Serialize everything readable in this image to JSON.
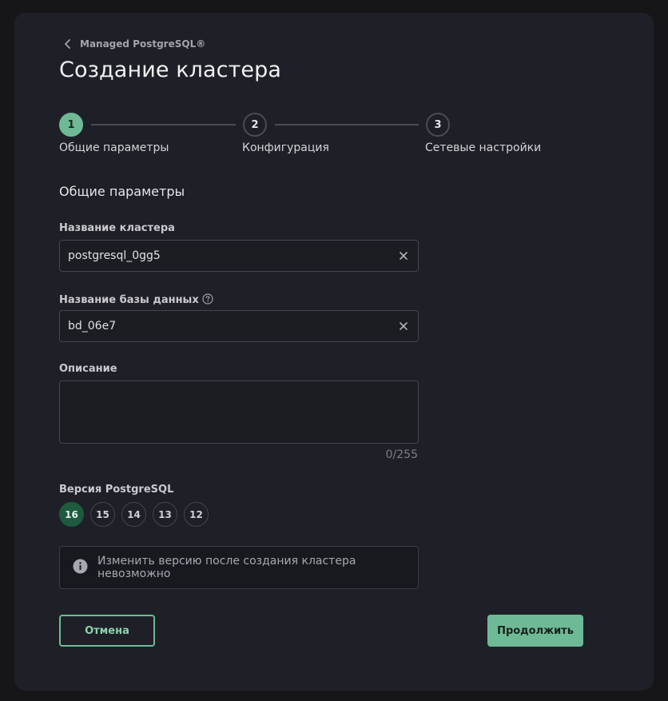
{
  "breadcrumb": {
    "label": "Managed PostgreSQL®",
    "icon": "chevron-left-icon"
  },
  "page": {
    "title": "Создание кластера"
  },
  "stepper": {
    "steps": [
      {
        "number": "1",
        "label": "Общие параметры",
        "state": "active"
      },
      {
        "number": "2",
        "label": "Конфигурация",
        "state": "inactive"
      },
      {
        "number": "3",
        "label": "Сетевые настройки",
        "state": "inactive"
      }
    ]
  },
  "section": {
    "title": "Общие параметры"
  },
  "form": {
    "cluster_name": {
      "label": "Название кластера",
      "value": "postgresql_0gg5",
      "clear_icon": "close-icon"
    },
    "db_name": {
      "label": "Название базы данных",
      "value": "bd_06e7",
      "help_icon": "help-circle-icon",
      "clear_icon": "close-icon"
    },
    "description": {
      "label": "Описание",
      "value": "",
      "counter": "0/255"
    },
    "version": {
      "label": "Версия PostgreSQL",
      "options": [
        "16",
        "15",
        "14",
        "13",
        "12"
      ],
      "selected": "16"
    }
  },
  "info": {
    "icon": "info-icon",
    "text": "Изменить версию после создания кластера невозможно"
  },
  "actions": {
    "cancel_label": "Отмена",
    "continue_label": "Продолжить"
  },
  "colors": {
    "accent": "#6eba96",
    "accent_dark": "#1e5a3e",
    "panel": "#1f2027",
    "background": "#161619"
  }
}
